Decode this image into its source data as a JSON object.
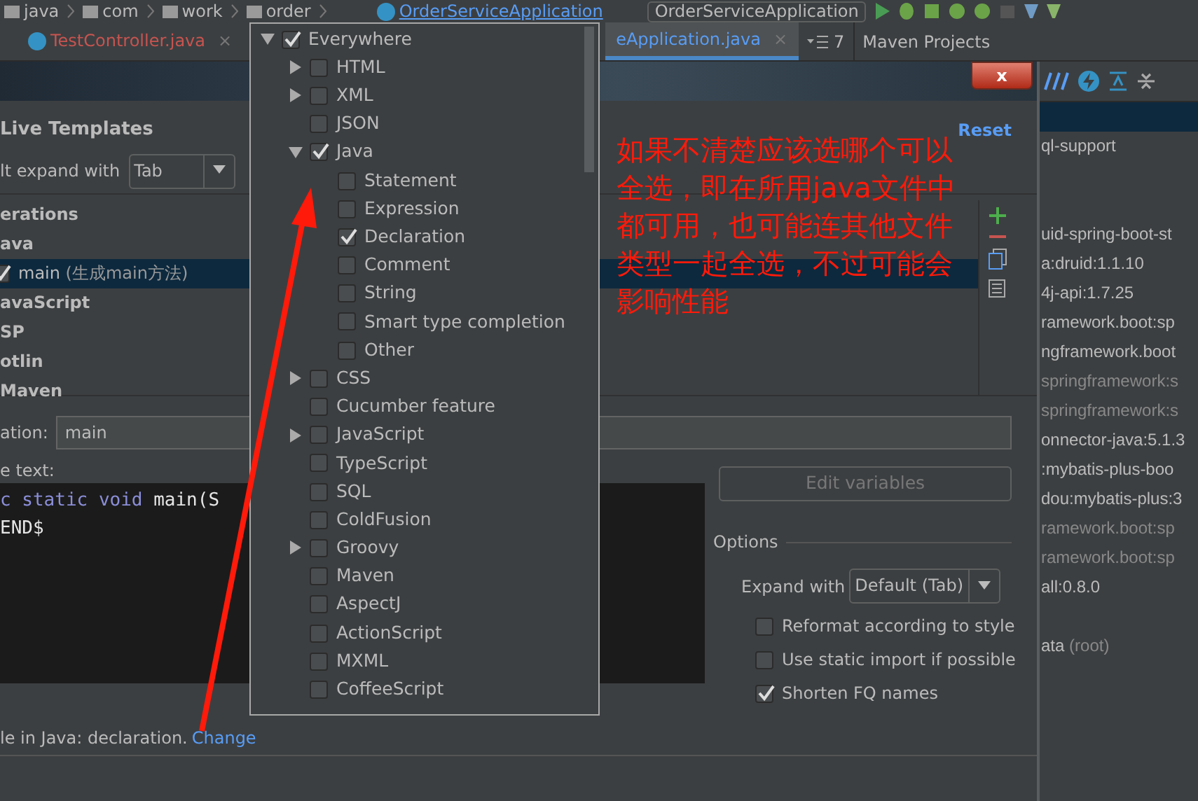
{
  "breadcrumbs": [
    {
      "label": "java",
      "kind": "folder"
    },
    {
      "label": "com",
      "kind": "folder"
    },
    {
      "label": "work",
      "kind": "folder"
    },
    {
      "label": "order",
      "kind": "folder"
    },
    {
      "label": "OrderServiceApplication",
      "kind": "class"
    }
  ],
  "run_config": {
    "label": "OrderServiceApplication"
  },
  "editor_tabs": [
    {
      "label": "TestController.java",
      "selected": false,
      "close": "×"
    },
    {
      "label": "eApplication.java",
      "selected": true,
      "close": "×"
    }
  ],
  "tab_overflow": {
    "label": "7"
  },
  "side_panel_title": "Maven Projects",
  "dialog": {
    "close": "x",
    "title": "Live Templates",
    "reset": "Reset",
    "expand_label": "lt expand with",
    "expand_value": "Tab",
    "groups": [
      {
        "label": "erations",
        "kind": "group"
      },
      {
        "label": "ava",
        "kind": "group"
      },
      {
        "label": "main",
        "note": "(生成main方法)",
        "kind": "template",
        "checked": true,
        "selected": true
      },
      {
        "label": "avaScript",
        "kind": "group"
      },
      {
        "label": "SP",
        "kind": "group"
      },
      {
        "label": "otlin",
        "kind": "group"
      },
      {
        "label": "Maven",
        "kind": "group"
      }
    ],
    "abbrev_label": "ation:",
    "abbrev_value": "main",
    "text_label": "e text:",
    "code_lines": [
      [
        {
          "text": "c static void",
          "kind": "keyword"
        },
        {
          "text": " main(S",
          "kind": "plain"
        }
      ],
      [
        {
          "text": "END$",
          "kind": "plain"
        }
      ]
    ],
    "edit_variables": {
      "label": "Edit variables",
      "disabled": true
    },
    "options_title": "Options",
    "options_expand_label": "Expand with",
    "options_expand_value": "Default (Tab)",
    "options": [
      {
        "label": "Reformat according to style",
        "checked": false
      },
      {
        "label": "Use static import if possible",
        "checked": false
      },
      {
        "label": "Shorten FQ names",
        "checked": true
      }
    ],
    "context_text": "le in Java: declaration.",
    "context_link": "Change"
  },
  "popup": {
    "items": [
      {
        "label": "Everywhere",
        "checked": true,
        "expanded": true,
        "children": [
          {
            "label": "HTML",
            "checked": false,
            "expanded": false
          },
          {
            "label": "XML",
            "checked": false,
            "expanded": false
          },
          {
            "label": "JSON",
            "checked": false
          },
          {
            "label": "Java",
            "checked": true,
            "expanded": true,
            "children": [
              {
                "label": "Statement",
                "checked": false
              },
              {
                "label": "Expression",
                "checked": false
              },
              {
                "label": "Declaration",
                "checked": true
              },
              {
                "label": "Comment",
                "checked": false
              },
              {
                "label": "String",
                "checked": false
              },
              {
                "label": "Smart type completion",
                "checked": false
              },
              {
                "label": "Other",
                "checked": false
              }
            ]
          },
          {
            "label": "CSS",
            "checked": false,
            "expanded": false
          },
          {
            "label": "Cucumber feature",
            "checked": false
          },
          {
            "label": "JavaScript",
            "checked": false,
            "expanded": false
          },
          {
            "label": "TypeScript",
            "checked": false
          },
          {
            "label": "SQL",
            "checked": false
          },
          {
            "label": "ColdFusion",
            "checked": false
          },
          {
            "label": "Groovy",
            "checked": false,
            "expanded": false
          },
          {
            "label": "Maven",
            "checked": false
          },
          {
            "label": "AspectJ",
            "checked": false
          },
          {
            "label": "ActionScript",
            "checked": false
          },
          {
            "label": "MXML",
            "checked": false
          },
          {
            "label": "CoffeeScript",
            "checked": false
          }
        ]
      }
    ]
  },
  "maven_items": [
    {
      "kind": "blank",
      "selected": true
    },
    {
      "kind": "item",
      "label": "ql-support"
    },
    {
      "kind": "blank"
    },
    {
      "kind": "blank"
    },
    {
      "kind": "item",
      "label": "uid-spring-boot-st"
    },
    {
      "kind": "item",
      "label": "a:druid:1.1.10"
    },
    {
      "kind": "item",
      "label": "4j-api:1.7.25"
    },
    {
      "kind": "item",
      "label": "ramework.boot:sp"
    },
    {
      "kind": "item",
      "label": "ngframework.boot"
    },
    {
      "kind": "item",
      "label": "springframework:s",
      "dim": true
    },
    {
      "kind": "item",
      "label": "springframework:s",
      "dim": true
    },
    {
      "kind": "item",
      "label": "onnector-java:5.1.3"
    },
    {
      "kind": "item",
      "label": ":mybatis-plus-boo"
    },
    {
      "kind": "item",
      "label": "dou:mybatis-plus:3"
    },
    {
      "kind": "item",
      "label": "ramework.boot:sp",
      "dim": true
    },
    {
      "kind": "item",
      "label": "ramework.boot:sp",
      "dim": true
    },
    {
      "kind": "item",
      "label": "all:0.8.0"
    },
    {
      "kind": "blank"
    },
    {
      "kind": "item",
      "label": "ata",
      "suffix": "(root)"
    }
  ],
  "annotation": {
    "text": "如果不清楚应该选哪个可以全选，即在所用java文件中都可用，也可能连其他文件类型一起全选，不过可能会影响性能"
  }
}
